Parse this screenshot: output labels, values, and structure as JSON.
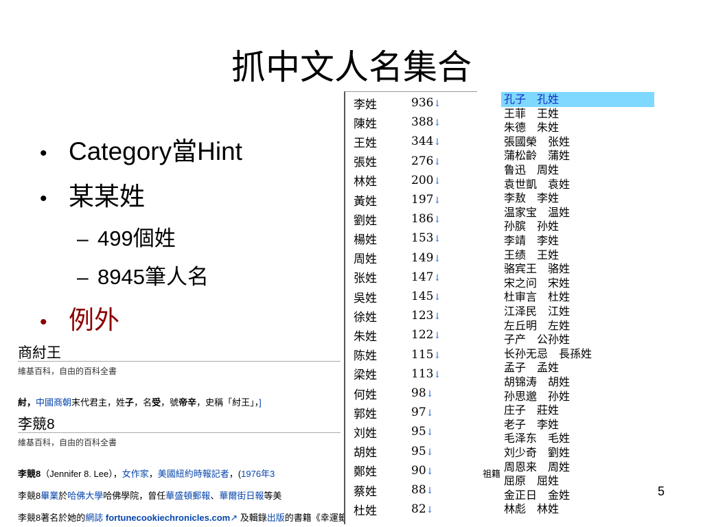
{
  "slide": {
    "title": "抓中文人名集合",
    "page_number": "5",
    "bullets": [
      {
        "dot": "•",
        "text": "Category當Hint"
      },
      {
        "dot": "•",
        "text": "某某姓"
      },
      {
        "dot": "•",
        "text": "例外"
      }
    ],
    "sub_bullets": [
      {
        "dash": "–",
        "text": "499個姓"
      },
      {
        "dash": "–",
        "text": "8945筆人名"
      }
    ],
    "colors": {
      "exception": "#8b0000",
      "link": "#0645ad",
      "selection": "#7fd8ff"
    }
  },
  "wiki": {
    "article1_title": "商紂王",
    "article1_sub": "維基百科，自由的百科全書",
    "article1_text_bold": "紂，",
    "article1_link": "中國商朝",
    "article1_text": "末代君主，姓",
    "article1_b2": "子",
    "article1_text2": "，名",
    "article1_b3": "受",
    "article1_text3": "，號",
    "article1_b4": "帝辛",
    "article1_text4": "，史稱「紂王」，",
    "article1_tail": "]",
    "article2_title": "李競8",
    "article2_sub": "維基百科，自由的百科全書",
    "article2_line1_bold": "李競8",
    "article2_line1_a": "（Jennifer 8. Lee），",
    "article2_line1_link1": "女作家",
    "article2_line1_b": "，",
    "article2_line1_link2": "美國紐約時報記者",
    "article2_line1_c": "，(",
    "article2_line1_link3": "1976年3",
    "article2_line1_tail": "，祖籍",
    "article2_line2_a": "李競8",
    "article2_line2_link1": "畢業",
    "article2_line2_b": "於",
    "article2_line2_link2": "哈佛大學",
    "article2_line2_c": "哈佛學院，曾任",
    "article2_line2_link3": "華盛頓郵報",
    "article2_line2_d": "、",
    "article2_line2_link4": "華爾街日報",
    "article2_line2_e": "等美",
    "article2_line3_a": "李競8著名於她的",
    "article2_line3_link1": "網誌",
    "article2_line3_link2": "fortunecookiechronicles.com",
    "article2_line3_b": "及輯錄",
    "article2_line3_link3": "出版",
    "article2_line3_c": "的書籍《幸運籤餅紀事》。文中報"
  },
  "surnames": [
    {
      "name": "李姓",
      "count": "936"
    },
    {
      "name": "陳姓",
      "count": "388"
    },
    {
      "name": "王姓",
      "count": "344"
    },
    {
      "name": "張姓",
      "count": "276"
    },
    {
      "name": "林姓",
      "count": "200"
    },
    {
      "name": "黃姓",
      "count": "197"
    },
    {
      "name": "劉姓",
      "count": "186"
    },
    {
      "name": "楊姓",
      "count": "153"
    },
    {
      "name": "周姓",
      "count": "149"
    },
    {
      "name": "张姓",
      "count": "147"
    },
    {
      "name": "吳姓",
      "count": "145"
    },
    {
      "name": "徐姓",
      "count": "123"
    },
    {
      "name": "朱姓",
      "count": "122"
    },
    {
      "name": "陈姓",
      "count": "115"
    },
    {
      "name": "梁姓",
      "count": "113"
    },
    {
      "name": "何姓",
      "count": "98"
    },
    {
      "name": "郭姓",
      "count": "97"
    },
    {
      "name": "刘姓",
      "count": "95"
    },
    {
      "name": "胡姓",
      "count": "95"
    },
    {
      "name": "鄭姓",
      "count": "90"
    },
    {
      "name": "蔡姓",
      "count": "88"
    },
    {
      "name": "杜姓",
      "count": "82"
    }
  ],
  "arrow_glyph": "↓",
  "names": [
    "孔子　孔姓",
    "王菲　王姓",
    "朱德　朱姓",
    "張國榮　张姓",
    "蒲松齡　蒲姓",
    "鲁迅　周姓",
    "袁世凱　袁姓",
    "李敖　李姓",
    "温家宝　温姓",
    "孙膑　孙姓",
    "李靖　李姓",
    "王绩　王姓",
    "骆宾王　骆姓",
    "宋之问　宋姓",
    "杜审言　杜姓",
    "江泽民　江姓",
    "左丘明　左姓",
    "子产　公孙姓",
    "长孙无忌　長孫姓",
    "孟子　孟姓",
    "胡锦涛　胡姓",
    "孙思邈　孙姓",
    "庄子　莊姓",
    "老子　李姓",
    "毛泽东　毛姓",
    "刘少奇　劉姓",
    "周恩来　周姓",
    "屈原　屈姓",
    "金正日　金姓",
    "林彪　林姓"
  ]
}
